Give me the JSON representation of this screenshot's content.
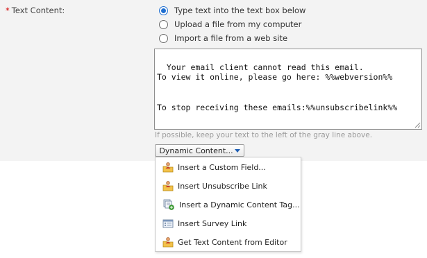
{
  "field": {
    "required_marker": "*",
    "label": "Text Content:"
  },
  "radios": [
    {
      "label": "Type text into the text box below",
      "selected": true
    },
    {
      "label": "Upload a file from my computer",
      "selected": false
    },
    {
      "label": "Import a file from a web site",
      "selected": false
    }
  ],
  "textarea": {
    "value": "Your email client cannot read this email.\nTo view it online, please go here: %%webversion%%\n\n\nTo stop receiving these emails:%%unsubscribelink%%"
  },
  "hint": "If possible, keep your text to the left of the gray line above.",
  "dynamic_button": {
    "label": "Dynamic Content...",
    "icon": "caret-down-icon"
  },
  "menu": {
    "items": [
      {
        "label": "Insert a Custom Field...",
        "icon": "user-folder-icon"
      },
      {
        "label": "Insert Unsubscribe Link",
        "icon": "user-folder-icon"
      },
      {
        "label": "Insert a Dynamic Content Tag...",
        "icon": "dynamic-tag-icon"
      },
      {
        "label": "Insert Survey Link",
        "icon": "survey-form-icon"
      },
      {
        "label": "Get Text Content from Editor",
        "icon": "user-folder-icon"
      }
    ]
  },
  "colors": {
    "radio_selected": "#1f6fd1",
    "required": "#d40000",
    "form_background": "#f3f3f3"
  }
}
